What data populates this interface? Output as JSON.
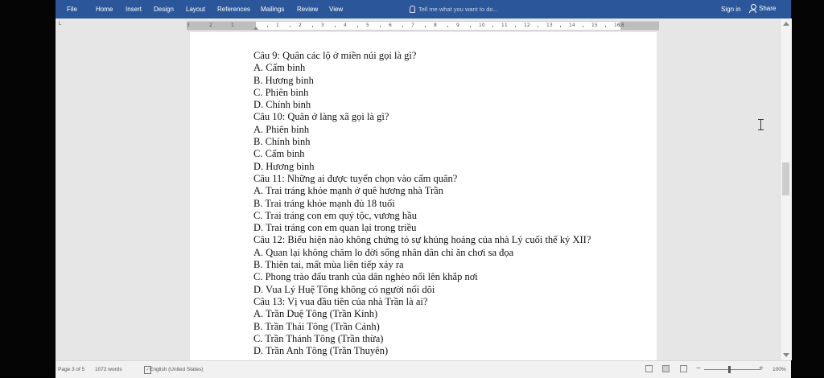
{
  "ribbon": {
    "tabs": [
      "File",
      "Home",
      "Insert",
      "Design",
      "Layout",
      "References",
      "Mailings",
      "Review",
      "View"
    ],
    "tell_me": "Tell me what you want to do...",
    "sign_in": "Sign in",
    "share": "Share"
  },
  "colors": {
    "ribbon": "#2b579a",
    "page": "#ffffff",
    "workspace": "#e6e6e6"
  },
  "ruler": {
    "corner": "L",
    "left_numbers": [
      "3",
      "2",
      "1"
    ],
    "numbers": [
      "1",
      "2",
      "3",
      "4",
      "5",
      "6",
      "7",
      "8",
      "9",
      "10",
      "11",
      "12",
      "13",
      "14",
      "15",
      "16"
    ],
    "end_number": "18"
  },
  "document": {
    "lines": [
      "Câu 9: Quân các lộ ở miền núi gọi là gì?",
      "A. Cấm binh",
      "B. Hương binh",
      "C. Phiên binh",
      "D. Chính binh",
      "Câu 10: Quân ở làng xã gọi là gì?",
      "A. Phiên binh",
      "B. Chính binh",
      "C. Cấm binh",
      "D. Hương binh",
      "Câu 11: Những ai được tuyển chọn vào cấm quân?",
      "A. Trai tráng khỏe mạnh ở quê hương nhà Trần",
      "B. Trai tráng khỏe mạnh đủ 18 tuổi",
      "C. Trai tráng con em quý tộc, vương hầu",
      "D. Trai tráng con em quan lại trong triều",
      "Câu 12: Biểu hiện nào không chứng tỏ sự khủng hoảng của nhà Lý cuối thế kỷ XII?",
      "A. Quan lại không chăm lo đời sống nhân dân chỉ ăn chơi sa đọa",
      "B. Thiên tai, mất mùa liên tiếp xảy ra",
      "C. Phong trào đấu tranh của dân nghèo nổi lên khắp nơi",
      "D. Vua Lý Huệ Tông không có người nối dõi",
      "Câu 13: Vị vua đầu tiên của nhà Trần là ai?",
      "A. Trần Duệ Tông (Trần Kính)",
      "B. Trần Thái Tông (Trần Cảnh)",
      "C. Trần Thánh Tông (Trần thừa)",
      "D. Trần Anh Tông (Trần Thuyên)"
    ]
  },
  "status": {
    "page": "Page 3 of 5",
    "words": "1072 words",
    "proofing_icon": "proofing-icon",
    "language": "English (United States)",
    "zoom": "100%"
  }
}
